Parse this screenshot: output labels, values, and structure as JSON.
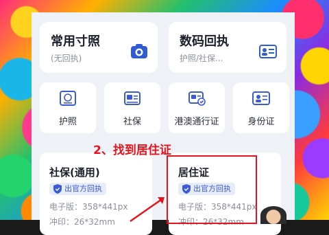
{
  "cards_top": [
    {
      "title": "常用寸照",
      "subtitle": "(无回执)",
      "icon": "camera-icon"
    },
    {
      "title": "数码回执",
      "subtitle": "护照/社保...",
      "icon": "id-card-icon"
    }
  ],
  "cards_small": [
    {
      "label": "护照",
      "icon": "passport-icon"
    },
    {
      "label": "社保",
      "icon": "social-security-card-icon"
    },
    {
      "label": "港澳通行证",
      "icon": "travel-permit-icon"
    },
    {
      "label": "身份证",
      "icon": "identity-card-icon"
    }
  ],
  "callout": "2、找到居住证",
  "cards_doc": [
    {
      "title": "社保(通用)",
      "badge": "出官方回执",
      "line1": "电子版：358*441px",
      "line2": "冲印：26*32mm"
    },
    {
      "title": "居住证",
      "badge": "出官方回执",
      "line1": "电子版：358*441px",
      "line2": "冲印：26*32mm"
    }
  ],
  "colors": {
    "accent": "#3a5ad8",
    "highlight": "#e5141c"
  }
}
